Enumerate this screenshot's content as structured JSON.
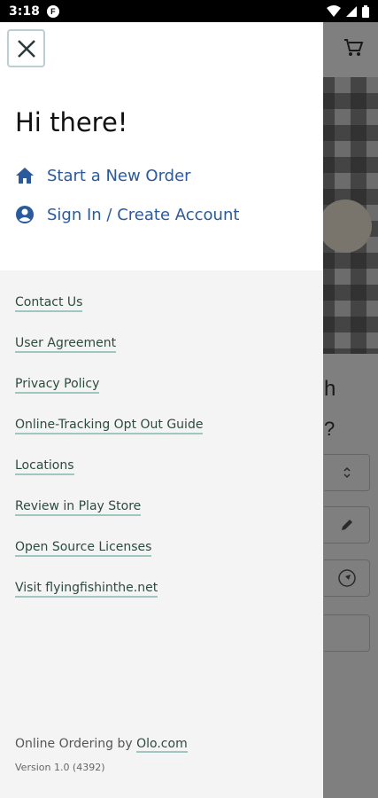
{
  "status_bar": {
    "time": "3:18",
    "notification_badge": "F"
  },
  "drawer": {
    "greeting": "Hi there!",
    "actions": [
      {
        "label": "Start a New Order",
        "icon": "home-icon"
      },
      {
        "label": "Sign In / Create Account",
        "icon": "account-circle-icon"
      }
    ],
    "links": [
      "Contact Us",
      "User Agreement",
      "Privacy Policy",
      "Online-Tracking Opt Out Guide",
      "Locations",
      "Review in Play Store",
      "Open Source Licenses",
      "Visit flyingfishinthe.net"
    ],
    "footer": {
      "powered_prefix": "Online Ordering by ",
      "powered_link": "Olo.com",
      "version": "Version 1.0 (4392)"
    }
  },
  "background": {
    "partial_text_1": "h",
    "partial_text_2": "?"
  },
  "colors": {
    "action_blue": "#2a5a9c",
    "link_text": "#2d4a3e",
    "link_underline": "#9fc6bf",
    "drawer_bg": "#f4f4f4"
  }
}
